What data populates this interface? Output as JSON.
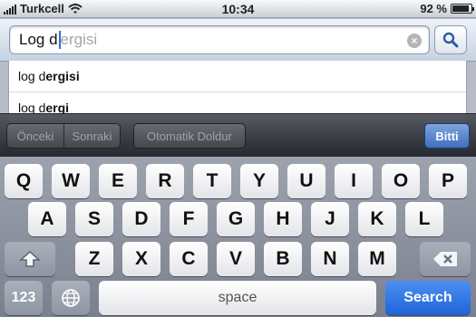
{
  "status": {
    "carrier": "Turkcell",
    "time": "10:34",
    "battery": "92 %",
    "battery_level": 0.92
  },
  "search": {
    "typed": "Log d",
    "completion": "ergisi"
  },
  "suggestions": [
    {
      "prefix": "log d",
      "rest": "ergisi"
    },
    {
      "prefix": "log d",
      "rest": "ergi"
    }
  ],
  "toolbar": {
    "previous": "Önceki",
    "next": "Sonraki",
    "autofill": "Otomatik Doldur",
    "done": "Bitti"
  },
  "keyboard": {
    "row1": [
      "Q",
      "W",
      "E",
      "R",
      "T",
      "Y",
      "U",
      "I",
      "O",
      "P"
    ],
    "row2": [
      "A",
      "S",
      "D",
      "F",
      "G",
      "H",
      "J",
      "K",
      "L"
    ],
    "row3": [
      "Z",
      "X",
      "C",
      "V",
      "B",
      "N",
      "M"
    ],
    "numbers": "123",
    "space": "space",
    "search": "Search"
  },
  "colors": {
    "search_key": "#1f63d8",
    "done_button": "#3f6fbf",
    "caret": "#2f6fd6"
  }
}
